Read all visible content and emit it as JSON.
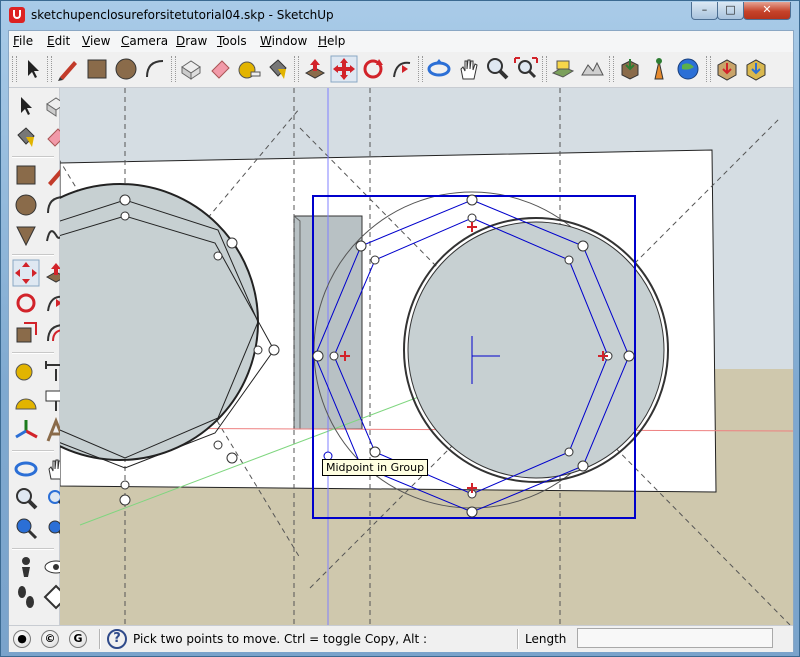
{
  "window": {
    "title": "sketchupenclosureforsitetutorial04.skp - SketchUp",
    "controls": {
      "minimize": "–",
      "maximize": "□",
      "close": "✕"
    }
  },
  "menu": [
    {
      "label": "File",
      "key": "F",
      "rest": "ile"
    },
    {
      "label": "Edit",
      "key": "E",
      "rest": "dit"
    },
    {
      "label": "View",
      "key": "V",
      "rest": "iew"
    },
    {
      "label": "Camera",
      "key": "C",
      "rest": "amera"
    },
    {
      "label": "Draw",
      "key": "D",
      "rest": "raw"
    },
    {
      "label": "Tools",
      "key": "T",
      "rest": "ools"
    },
    {
      "label": "Window",
      "key": "W",
      "rest": "indow"
    },
    {
      "label": "Help",
      "key": "H",
      "rest": "elp"
    }
  ],
  "toolbar_icons": [
    "select-icon",
    "pencil-icon",
    "rectangle-icon",
    "circle-icon",
    "arc-icon",
    "make-component-icon",
    "eraser-icon",
    "tape-measure-icon",
    "paint-bucket-icon",
    "push-pull-icon",
    "move-icon",
    "rotate-icon",
    "follow-me-icon",
    "orbit-icon",
    "pan-icon",
    "zoom-icon",
    "zoom-extents-icon",
    "add-location-icon",
    "toggle-terrain-icon",
    "get-models-icon",
    "share-model-icon",
    "google-earth-icon",
    "component-warehouse-icon",
    "extension-warehouse-icon"
  ],
  "sidebar_icons": [
    "select-icon",
    "make-component-icon",
    "paint-bucket-icon",
    "eraser-icon",
    "rectangle-icon",
    "line-icon",
    "circle-icon",
    "arc-icon",
    "polygon-icon",
    "freehand-icon",
    "move-icon",
    "push-pull-icon",
    "rotate-icon",
    "follow-me-icon",
    "scale-icon",
    "offset-icon",
    "tape-measure-icon",
    "dimension-icon",
    "protractor-icon",
    "text-icon",
    "axes-icon",
    "3d-text-icon",
    "orbit-icon",
    "pan-icon",
    "zoom-icon",
    "zoom-window-icon",
    "previous-view-icon",
    "zoom-extents-icon",
    "position-camera-icon",
    "look-around-icon",
    "walk-icon",
    "section-plane-icon"
  ],
  "viewport": {
    "tooltip": "Midpoint in Group",
    "colors": {
      "sky": "#d5dde3",
      "ground": "#cfc8ad",
      "panel": "#ffffff",
      "selection": "#0000cc",
      "guide": "#555555"
    }
  },
  "status": {
    "icons": [
      "geo-location-icon",
      "credits-icon",
      "user-icon"
    ],
    "icon_glyphs": [
      "●",
      "©",
      "G"
    ],
    "help": "?",
    "message": "Pick two points to move.  Ctrl = toggle Copy, Alt :",
    "vcb_label": "Length",
    "vcb_value": ""
  }
}
